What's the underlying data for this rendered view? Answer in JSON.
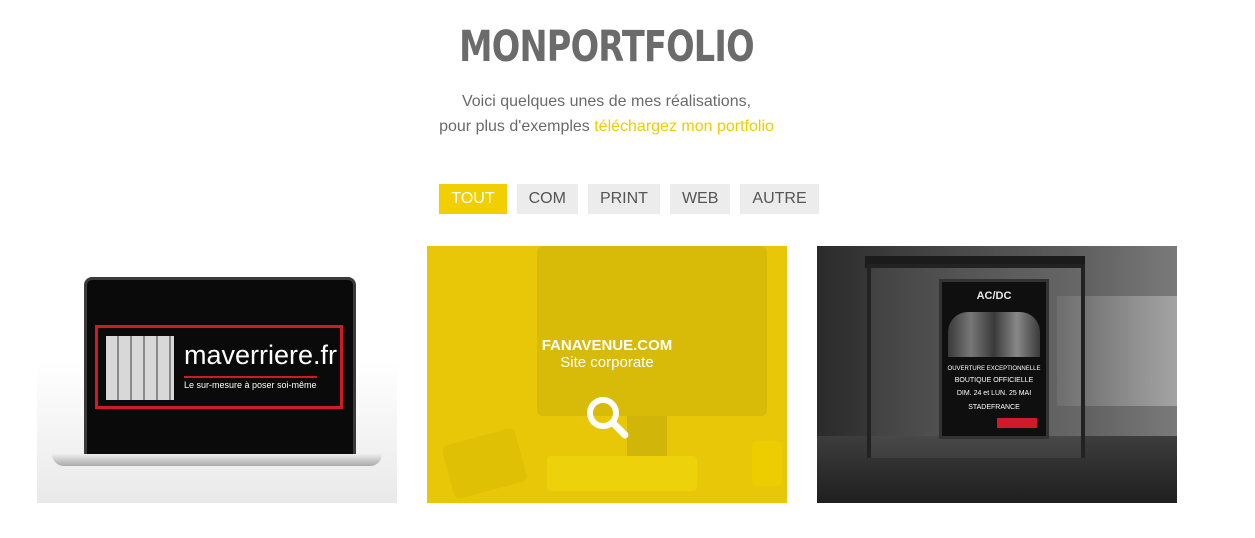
{
  "header": {
    "title": "MONPORTFOLIO",
    "intro_line1": "Voici quelques unes de mes réalisations,",
    "intro_line2_prefix": "pour plus d'exemples ",
    "intro_link": "téléchargez mon portfolio"
  },
  "filters": {
    "tout": "TOUT",
    "com": "COM",
    "print": "PRINT",
    "web": "WEB",
    "autre": "AUTRE",
    "active": "TOUT"
  },
  "portfolio": {
    "item1": {
      "brand": "maverriere.fr",
      "tagline": "Le sur-mesure à poser soi-même"
    },
    "item2": {
      "title": "FANAVENUE.COM",
      "subtitle": "Site corporate",
      "icon": "search-icon"
    },
    "item3": {
      "band": "AC/DC",
      "line1": "OUVERTURE EXCEPTIONNELLE",
      "line2": "BOUTIQUE OFFICIELLE",
      "line3": "DIM. 24 et LUN. 25 MAI",
      "venue": "STADEFRANCE"
    }
  },
  "colors": {
    "accent": "#f2cf00",
    "title": "#6b6b6b",
    "filter_bg": "#ececec"
  }
}
